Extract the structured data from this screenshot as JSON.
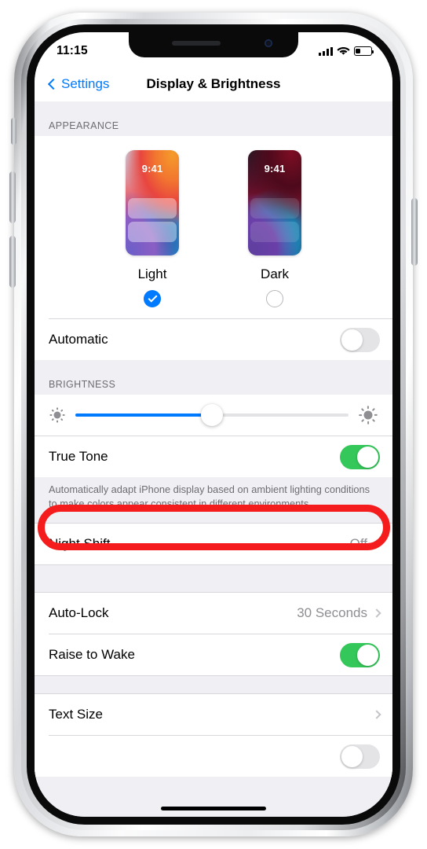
{
  "status_bar": {
    "time": "11:15",
    "signal_icon": "cellular-bars-icon",
    "wifi_icon": "wifi-icon",
    "battery_icon": "battery-icon",
    "battery_level_percent": 30
  },
  "nav": {
    "back_label": "Settings",
    "back_icon": "chevron-left-icon",
    "title": "Display & Brightness"
  },
  "appearance": {
    "header": "APPEARANCE",
    "options": [
      {
        "name": "Light",
        "preview_time": "9:41",
        "selected": true
      },
      {
        "name": "Dark",
        "preview_time": "9:41",
        "selected": false
      }
    ],
    "automatic": {
      "label": "Automatic",
      "enabled": false
    }
  },
  "brightness": {
    "header": "BRIGHTNESS",
    "slider": {
      "value_percent": 50,
      "low_icon": "sun-low-icon",
      "high_icon": "sun-high-icon"
    },
    "true_tone": {
      "label": "True Tone",
      "enabled": true
    },
    "footnote": "Automatically adapt iPhone display based on ambient lighting conditions to make colors appear consistent in different environments.",
    "night_shift": {
      "label": "Night Shift",
      "value": "Off"
    }
  },
  "lock": {
    "auto_lock": {
      "label": "Auto-Lock",
      "value": "30 Seconds"
    },
    "raise_to_wake": {
      "label": "Raise to Wake",
      "enabled": true
    }
  },
  "text": {
    "text_size": {
      "label": "Text Size"
    }
  },
  "annotation": {
    "shape": "oval",
    "color": "#f41c1c",
    "targets": "brightness-slider-row"
  },
  "colors": {
    "accent_blue": "#007aff",
    "toggle_on_green": "#34c759",
    "group_background": "#efeff4",
    "secondary_text": "#8e8e93",
    "annotation_red": "#f41c1c"
  }
}
